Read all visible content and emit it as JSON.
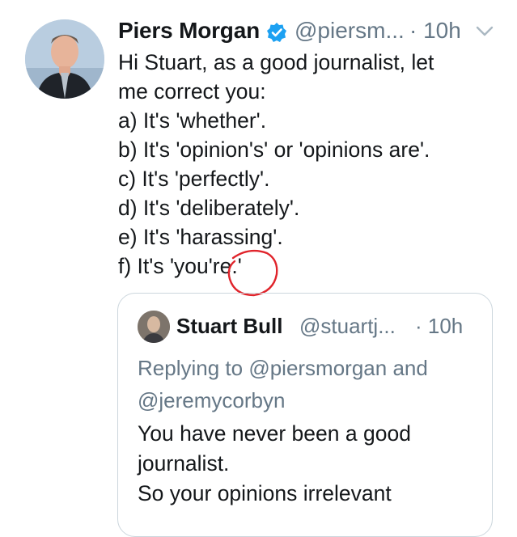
{
  "tweet": {
    "author_name": "Piers Morgan",
    "author_handle": "@piersm...",
    "timestamp": "· 10h",
    "verified": true,
    "body_lines": [
      "Hi Stuart, as a good journalist, let",
      "me correct you:",
      "a) It's 'whether'.",
      "b) It's 'opinion's' or 'opinions are'.",
      "c) It's 'perfectly'.",
      "d) It's 'deliberately'.",
      "e) It's 'harassing'.",
      "f) It's 'you're.'"
    ],
    "annotation_color": "#e0242b"
  },
  "quoted_tweet": {
    "author_name": "Stuart Bull",
    "author_handle": "@stuartj...",
    "timestamp": "· 10h",
    "replying_prefix": "Replying to",
    "reply_to_1": "@piersmorgan",
    "reply_and": "and",
    "reply_to_2": "@jeremycorbyn",
    "body_lines": [
      "You have never been a good",
      "journalist.",
      "So your opinions irrelevant"
    ]
  },
  "colors": {
    "verified_blue": "#1da1f2",
    "secondary_text": "#657786",
    "border": "#ccd6dd"
  }
}
